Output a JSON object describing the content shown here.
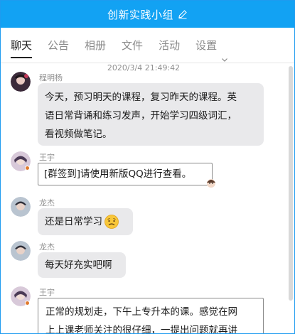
{
  "window": {
    "title": "创新实践小组",
    "edit_icon": "pencil-icon"
  },
  "tabs": [
    {
      "label": "聊天",
      "active": true
    },
    {
      "label": "公告",
      "active": false
    },
    {
      "label": "相册",
      "active": false
    },
    {
      "label": "文件",
      "active": false
    },
    {
      "label": "活动",
      "active": false
    },
    {
      "label": "设置",
      "active": false,
      "icon": "chevron-down-icon"
    }
  ],
  "chat": {
    "timestamp": "2020/3/4 21:49:42",
    "messages": [
      {
        "sender": "程明杨",
        "lines": [
          "今天，预习明天的课程，复习昨天的课程。英",
          "语日常背诵和练习发声，开始学习四级词汇，",
          "看视频做笔记。"
        ]
      },
      {
        "sender": "王宇",
        "lines": [
          "[群签到]请使用新版QQ进行查看。"
        ]
      },
      {
        "sender": "龙杰",
        "lines": [
          "还是日常学习"
        ],
        "emoji": "worried-face-icon"
      },
      {
        "sender": "龙杰",
        "lines": [
          "每天好充实吧啊"
        ]
      },
      {
        "sender": "王宇",
        "lines": [
          "正常的规划走，下午上专升本的课。感觉在网",
          "上上课老师关注的很仔细，一提出问题就再讲"
        ]
      }
    ]
  },
  "colors": {
    "titlebar": "#12a2f3",
    "bubble": "#e9e9eb"
  }
}
